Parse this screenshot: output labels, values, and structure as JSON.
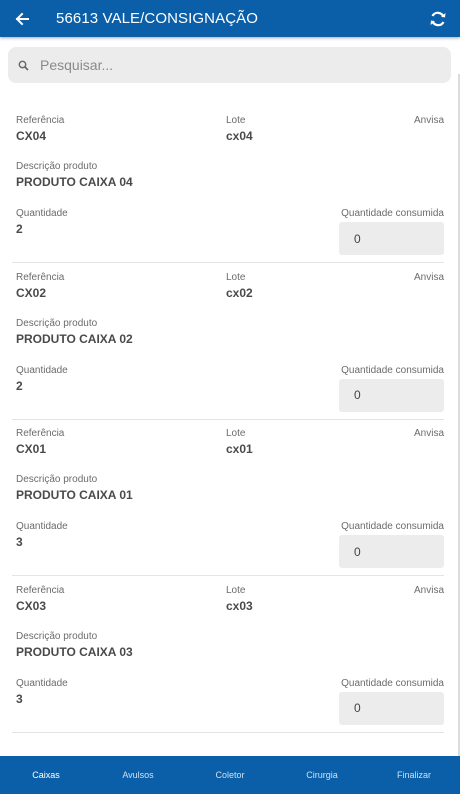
{
  "header": {
    "title": "56613 VALE/CONSIGNAÇÃO",
    "back_icon": "arrow-left-icon",
    "refresh_icon": "refresh-icon"
  },
  "search": {
    "placeholder": "Pesquisar...",
    "value": ""
  },
  "labels": {
    "referencia": "Referência",
    "lote": "Lote",
    "anvisa": "Anvisa",
    "descricao": "Descrição produto",
    "quantidade": "Quantidade",
    "quantidade_consumida": "Quantidade consumida"
  },
  "items": [
    {
      "referencia": "CX04",
      "lote": "cx04",
      "descricao": "PRODUTO CAIXA 04",
      "quantidade": "2",
      "consumida": "0"
    },
    {
      "referencia": "CX02",
      "lote": "cx02",
      "descricao": "PRODUTO CAIXA 02",
      "quantidade": "2",
      "consumida": "0"
    },
    {
      "referencia": "CX01",
      "lote": "cx01",
      "descricao": "PRODUTO CAIXA 01",
      "quantidade": "3",
      "consumida": "0"
    },
    {
      "referencia": "CX03",
      "lote": "cx03",
      "descricao": "PRODUTO CAIXA 03",
      "quantidade": "3",
      "consumida": "0"
    }
  ],
  "tabs": [
    {
      "label": "Caixas",
      "active": true
    },
    {
      "label": "Avulsos",
      "active": false
    },
    {
      "label": "Coletor",
      "active": false
    },
    {
      "label": "Cirurgia",
      "active": false
    },
    {
      "label": "Finalizar",
      "active": false
    }
  ],
  "colors": {
    "primary": "#0b5fa8",
    "field_bg": "#ececec"
  }
}
